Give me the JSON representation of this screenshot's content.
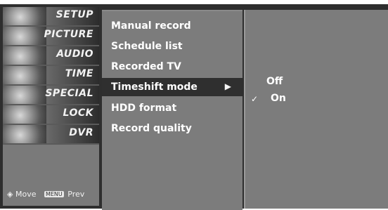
{
  "sidebar": {
    "items": [
      {
        "label": "SETUP"
      },
      {
        "label": "PICTURE"
      },
      {
        "label": "AUDIO"
      },
      {
        "label": "TIME"
      },
      {
        "label": "SPECIAL"
      },
      {
        "label": "LOCK"
      },
      {
        "label": "DVR"
      }
    ],
    "footer": {
      "move_label": "Move",
      "prev_key": "MENU",
      "prev_label": "Prev"
    }
  },
  "menu": {
    "items": [
      {
        "label": "Manual record"
      },
      {
        "label": "Schedule list"
      },
      {
        "label": "Recorded TV"
      },
      {
        "label": "Timeshift mode",
        "selected": true,
        "arrow": "▶"
      },
      {
        "label": "HDD format"
      },
      {
        "label": "Record quality"
      }
    ]
  },
  "submenu": {
    "options": [
      {
        "label": "Off"
      },
      {
        "label": "On",
        "check": "✓"
      }
    ]
  },
  "colors": {
    "panel": "#7c7c7c",
    "selected": "#2f2f2f",
    "text": "#ffffff"
  }
}
